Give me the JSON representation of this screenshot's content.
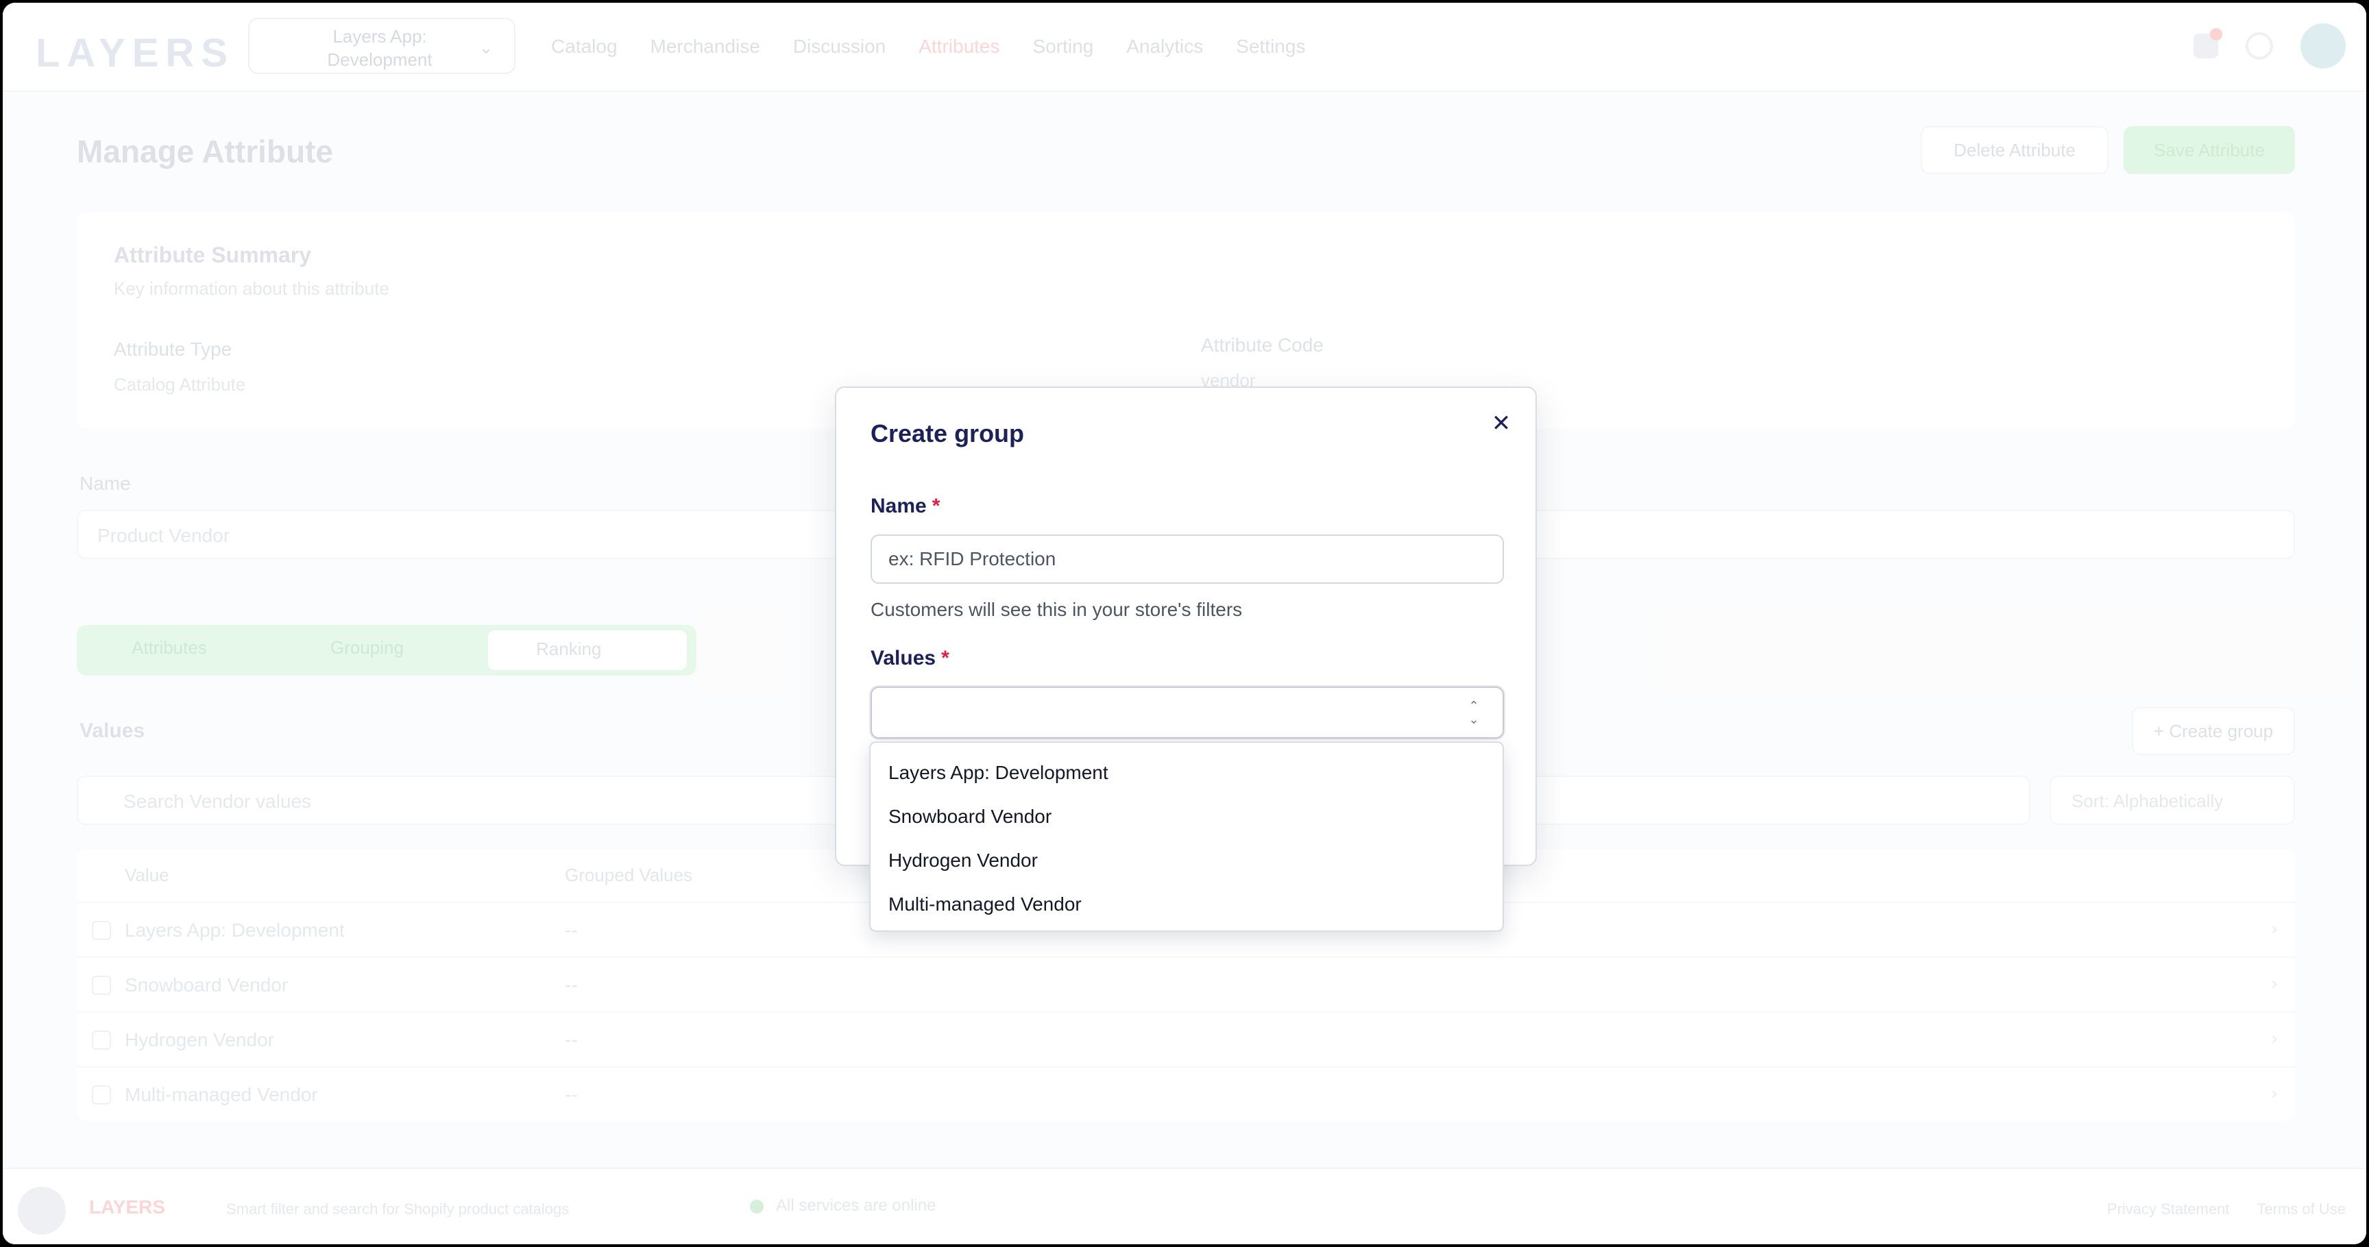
{
  "topbar": {
    "logo": "LAYERS",
    "store_name": "Layers App: Development",
    "nav": [
      "Catalog",
      "Merchandise",
      "Discussion",
      "Attributes",
      "Sorting",
      "Analytics",
      "Settings"
    ],
    "nav_active_index": 3
  },
  "page": {
    "title": "Manage Attribute",
    "delete_label": "Delete Attribute",
    "save_label": "Save Attribute"
  },
  "summary": {
    "title": "Attribute Summary",
    "subtitle": "Key information about this attribute",
    "type_label": "Attribute Type",
    "type_value": "Catalog Attribute",
    "code_label": "Attribute Code",
    "code_value": "vendor"
  },
  "name_field": {
    "label": "Name",
    "value": "Product Vendor"
  },
  "segments": {
    "items": [
      "Attributes",
      "Grouping",
      "Ranking"
    ]
  },
  "values_section": {
    "title": "Values",
    "create_group_label": "+ Create group",
    "search_placeholder": "Search Vendor values",
    "sort_label": "Sort: Alphabetically",
    "columns": [
      "Value",
      "Grouped Values"
    ],
    "rows": [
      {
        "name": "Layers App: Development",
        "grouped": "--"
      },
      {
        "name": "Snowboard Vendor",
        "grouped": "--"
      },
      {
        "name": "Hydrogen Vendor",
        "grouped": "--"
      },
      {
        "name": "Multi-managed Vendor",
        "grouped": "--"
      }
    ]
  },
  "footer": {
    "brand": "LAYERS",
    "description": "Smart filter and search for Shopify product catalogs",
    "status": "All services are online",
    "links": [
      "Privacy Statement",
      "Terms of Use"
    ]
  },
  "modal": {
    "title": "Create group",
    "name_label": "Name",
    "name_placeholder": "ex: RFID Protection",
    "name_help": "Customers will see this in your store's filters",
    "values_label": "Values",
    "required_mark": "*",
    "close_icon": "close-icon",
    "options": [
      "Layers App: Development",
      "Snowboard Vendor",
      "Hydrogen Vendor",
      "Multi-managed Vendor"
    ]
  },
  "colors": {
    "modal_title": "#1d2159",
    "required": "#e11d48",
    "accent_green": "#22c55e",
    "accent_red": "#ef4444"
  }
}
